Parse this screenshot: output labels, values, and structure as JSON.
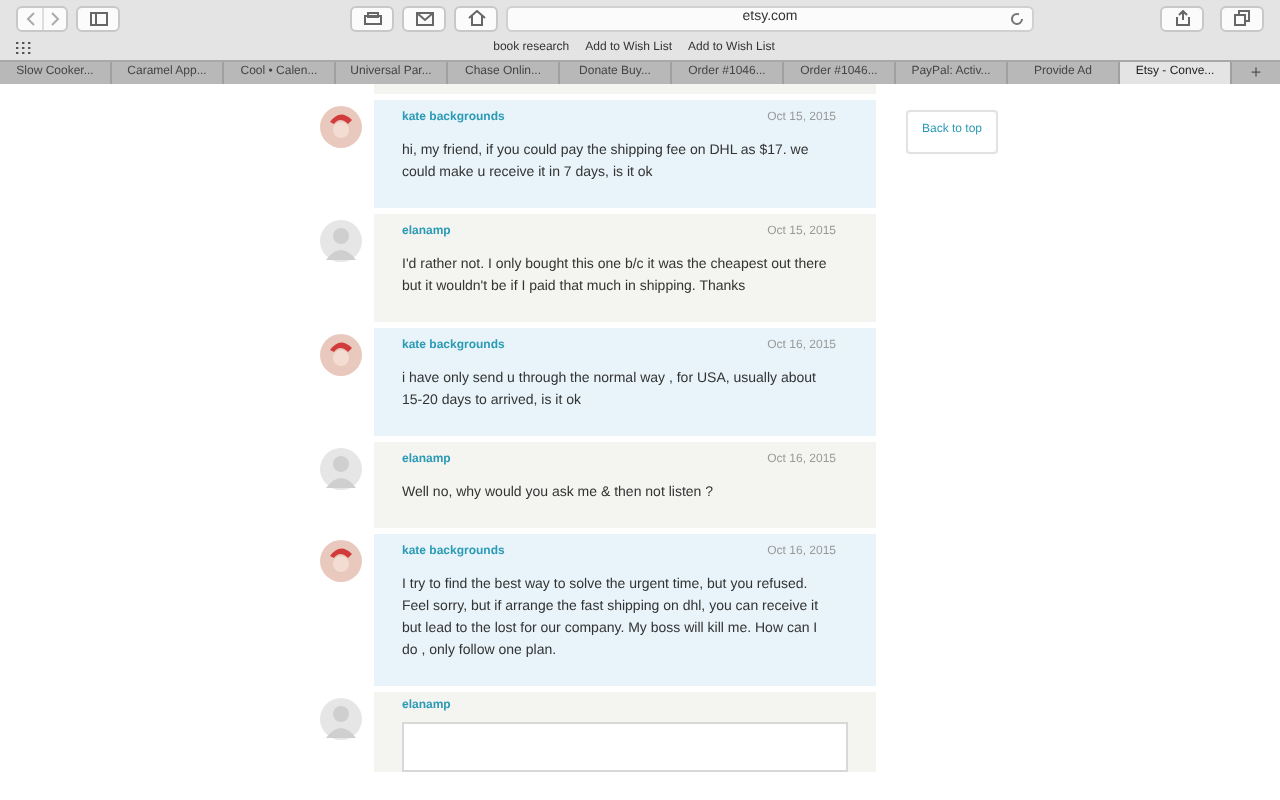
{
  "toolbar": {
    "address": "etsy.com"
  },
  "bookmarks": [
    "book research",
    "Add to Wish List",
    "Add to Wish List"
  ],
  "tabs": [
    {
      "label": "Slow Cooker...",
      "selected": false
    },
    {
      "label": "Caramel App...",
      "selected": false
    },
    {
      "label": "Cool • Calen...",
      "selected": false
    },
    {
      "label": "Universal Par...",
      "selected": false
    },
    {
      "label": "Chase Onlin...",
      "selected": false
    },
    {
      "label": "Donate Buy...",
      "selected": false
    },
    {
      "label": "Order #1046...",
      "selected": false
    },
    {
      "label": "Order #1046...",
      "selected": false
    },
    {
      "label": "PayPal: Activ...",
      "selected": false
    },
    {
      "label": "Provide Ad",
      "selected": false
    },
    {
      "label": "Etsy - Conve...",
      "selected": true
    }
  ],
  "new_tab": "+",
  "messages": [
    {
      "kind": "seller",
      "author": "kate backgrounds",
      "date": "Oct 15, 2015",
      "text": "hi, my friend, if you could pay the shipping fee on DHL as $17. we could make u receive it in 7 days, is it ok"
    },
    {
      "kind": "buyer",
      "author": "elanamp",
      "date": "Oct 15, 2015",
      "text": "I'd rather not. I only bought this one b/c it was the cheapest out there but it wouldn't be if I paid that much in shipping. Thanks"
    },
    {
      "kind": "seller",
      "author": "kate backgrounds",
      "date": "Oct 16, 2015",
      "text": "i have only send u through the normal way , for USA, usually about 15-20 days to arrived, is it ok"
    },
    {
      "kind": "buyer",
      "author": "elanamp",
      "date": "Oct 16, 2015",
      "text": "Well no, why would you ask me & then not listen ?"
    },
    {
      "kind": "seller",
      "author": "kate backgrounds",
      "date": "Oct 16, 2015",
      "text": "I try to find the best way to solve the urgent time, but you refused. Feel sorry, but if arrange the fast shipping on dhl, you can receive it but lead to the lost for our company. My boss will kill me. How can I do , only follow one plan."
    }
  ],
  "composer": {
    "author": "elanamp"
  },
  "back_to_top": "Back to top"
}
